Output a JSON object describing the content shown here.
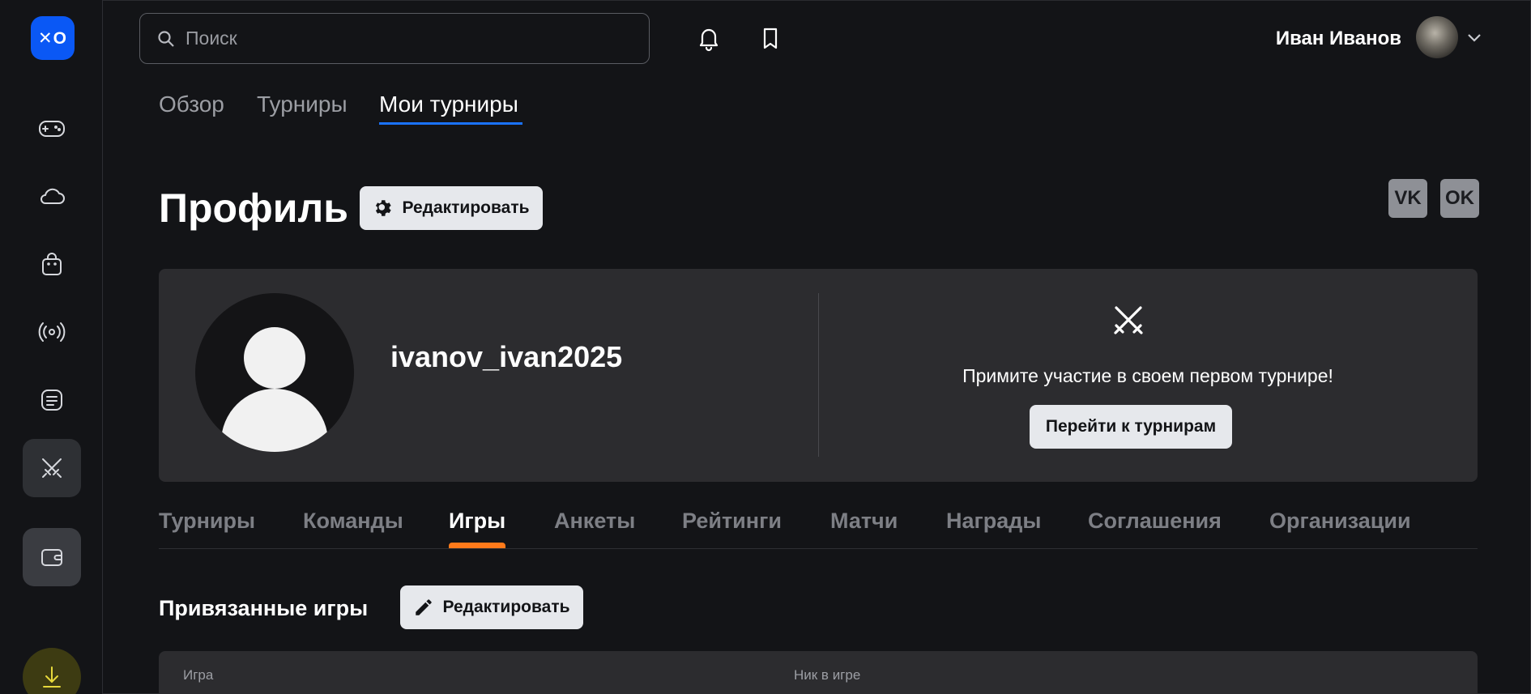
{
  "app": {
    "logo_text": "✕O",
    "accent_color": "#0a58f5"
  },
  "sidebar": {
    "items": [
      {
        "name": "gamepad-icon",
        "active": false
      },
      {
        "name": "cloud-icon",
        "active": false
      },
      {
        "name": "shopping-bag-icon",
        "active": false
      },
      {
        "name": "broadcast-icon",
        "active": false
      },
      {
        "name": "news-icon",
        "active": false
      },
      {
        "name": "tournaments-swords-icon",
        "active": true
      },
      {
        "name": "wallet-icon",
        "active": false
      },
      {
        "name": "download-icon",
        "active": false
      }
    ]
  },
  "header": {
    "search_placeholder": "Поиск",
    "user_name": "Иван Иванов",
    "icons": [
      "bell-icon",
      "bookmark-icon",
      "chevron-down-icon"
    ]
  },
  "top_tabs": [
    {
      "label": "Обзор",
      "active": false
    },
    {
      "label": "Турниры",
      "active": false
    },
    {
      "label": "Мои турниры",
      "active": true
    }
  ],
  "profile": {
    "title": "Профиль",
    "edit_label": "Редактировать",
    "social": [
      "VK",
      "OK"
    ],
    "username": "ivanov_ivan2025",
    "invite_text": "Примите участие в своем первом турнире!",
    "go_tournaments_label": "Перейти к турнирам"
  },
  "profile_tabs": [
    {
      "label": "Турниры",
      "active": false
    },
    {
      "label": "Команды",
      "active": false
    },
    {
      "label": "Игры",
      "active": true
    },
    {
      "label": "Анкеты",
      "active": false
    },
    {
      "label": "Рейтинги",
      "active": false
    },
    {
      "label": "Матчи",
      "active": false
    },
    {
      "label": "Награды",
      "active": false
    },
    {
      "label": "Соглашения",
      "active": false
    },
    {
      "label": "Организации",
      "active": false
    }
  ],
  "linked_games": {
    "title": "Привязанные игры",
    "edit_label": "Редактировать",
    "columns": [
      "Игра",
      "Ник в игре"
    ]
  }
}
